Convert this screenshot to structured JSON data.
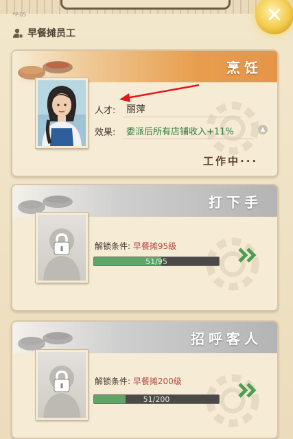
{
  "page_code": "*P.05",
  "header": {
    "title": "早餐摊员工"
  },
  "colors": {
    "accent_orange": "#e89d4d",
    "progress_green": "#5aa766",
    "requirement_red": "#b4463e",
    "value_green": "#2d7a3a"
  },
  "cards": [
    {
      "title": "烹饪",
      "state": "assigned",
      "talent_label": "人才:",
      "talent_name": "丽萍",
      "effect_label": "效果:",
      "effect_text": "委派后所有店铺收入+11%",
      "status_text": "工作中···"
    },
    {
      "title": "打下手",
      "state": "locked",
      "unlock_label": "解锁条件:",
      "unlock_requirement": "早餐摊95级",
      "progress": {
        "current": 51,
        "max": 95,
        "text": "51/95"
      }
    },
    {
      "title": "招呼客人",
      "state": "locked",
      "unlock_label": "解锁条件:",
      "unlock_requirement": "早餐摊200级",
      "progress": {
        "current": 51,
        "max": 200,
        "text": "51/200"
      }
    }
  ],
  "icons": {
    "header": "staff-person-icon",
    "close": "close-icon",
    "lock": "lock-icon",
    "upgrade": "arrow-up-icon",
    "go": "double-chevron-right-icon"
  }
}
